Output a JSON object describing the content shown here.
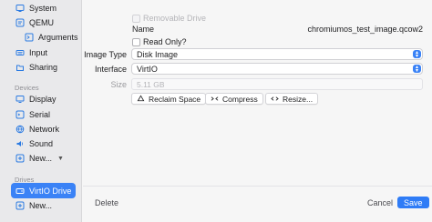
{
  "sidebar": {
    "items_top": [
      {
        "label": "System",
        "icon": "system-icon"
      },
      {
        "label": "QEMU",
        "icon": "qemu-icon"
      },
      {
        "label": "Arguments",
        "icon": "arguments-icon"
      },
      {
        "label": "Input",
        "icon": "input-icon"
      },
      {
        "label": "Sharing",
        "icon": "sharing-icon"
      }
    ],
    "devices_header": "Devices",
    "devices": [
      {
        "label": "Display",
        "icon": "display-icon"
      },
      {
        "label": "Serial",
        "icon": "serial-icon"
      },
      {
        "label": "Network",
        "icon": "network-icon"
      },
      {
        "label": "Sound",
        "icon": "sound-icon"
      },
      {
        "label": "New...",
        "icon": "plus-icon"
      }
    ],
    "drives_header": "Drives",
    "drives": [
      {
        "label": "VirtIO Drive",
        "icon": "drive-icon"
      },
      {
        "label": "New...",
        "icon": "plus-icon"
      }
    ]
  },
  "form": {
    "removable_label": "Removable Drive",
    "name_label": "Name",
    "name_value": "chromiumos_test_image.qcow2",
    "readonly_label": "Read Only?",
    "image_type_label": "Image Type",
    "image_type_value": "Disk Image",
    "interface_label": "Interface",
    "interface_value": "VirtIO",
    "size_label": "Size",
    "size_value": "5.11 GB",
    "reclaim_label": "Reclaim Space",
    "compress_label": "Compress",
    "resize_label": "Resize..."
  },
  "footer": {
    "delete_label": "Delete",
    "cancel_label": "Cancel",
    "save_label": "Save"
  },
  "colors": {
    "accent": "#3a82f6",
    "sidebar_bg": "#e9e9eb"
  }
}
